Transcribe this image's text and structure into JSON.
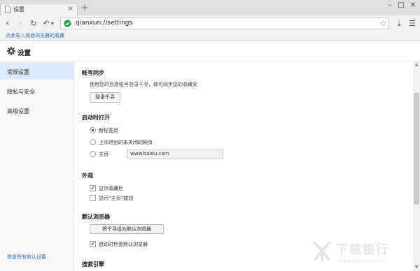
{
  "tab": {
    "title": "设置",
    "close": "×",
    "new_tab": "+"
  },
  "window": {
    "minimize": "–",
    "maximize": "□",
    "close": "✕"
  },
  "toolbar": {
    "back": "‹",
    "forward": "›",
    "reload": "↻",
    "undo": "↶",
    "undo_menu": "▾",
    "url": "qianxun://settings",
    "star": "☆",
    "download": "⤓",
    "menu": "☰"
  },
  "bookmarks_bar": {
    "import_link": "点此导入其他浏览器的收藏"
  },
  "header": {
    "title": "设置"
  },
  "sidebar": {
    "items": [
      {
        "label": "常规设置",
        "active": true
      },
      {
        "label": "隐私与安全",
        "active": false
      },
      {
        "label": "高级设置",
        "active": false
      }
    ],
    "restore_link": "恢复所有默认设置"
  },
  "sections": {
    "account": {
      "title": "帐号同步",
      "desc": "使用您的百度帐号登录千寻，即可同步您的收藏夹",
      "login_button": "登录千寻"
    },
    "startup": {
      "title": "启动时打开",
      "options": [
        "新标签页",
        "上次退出时未关闭的网页",
        "主页"
      ],
      "selected": 0,
      "homepage_value": "www.baidu.com"
    },
    "appearance": {
      "title": "外观",
      "show_bookmarks_bar": {
        "label": "显示收藏栏",
        "checked": true
      },
      "show_home_button": {
        "label": "显示“主页”按钮",
        "checked": false
      }
    },
    "default_browser": {
      "title": "默认浏览器",
      "set_default_button": "将千寻设为默认浏览器",
      "check_on_startup": {
        "label": "启动时检查默认浏览器",
        "checked": true
      }
    },
    "search_engine": {
      "title": "搜索引擎"
    }
  },
  "scrollbar": {
    "up": "▲",
    "down": "▼"
  },
  "watermark": {
    "text": "下载银行",
    "url": "www.downbank.cn"
  }
}
